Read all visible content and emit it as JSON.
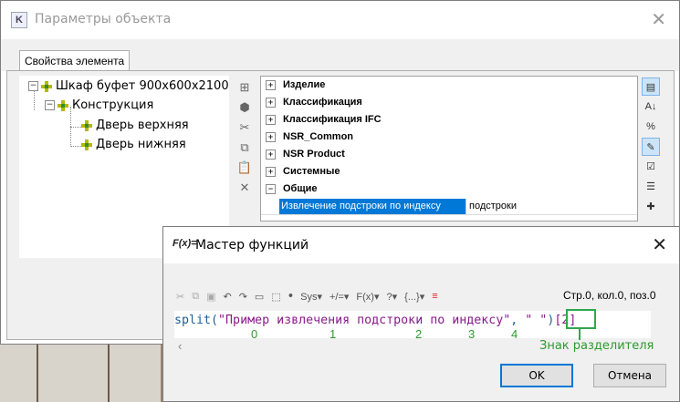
{
  "main_dialog": {
    "title": "Параметры объекта",
    "tab": "Свойства элемента",
    "tree": [
      {
        "label": "Шкаф буфет 900x600x2100",
        "expander": "−"
      },
      {
        "label": "Конструкция",
        "expander": "−"
      },
      {
        "label": "Дверь верхняя"
      },
      {
        "label": "Дверь нижняя"
      }
    ],
    "property_groups": [
      {
        "label": "Изделие",
        "expander": "+"
      },
      {
        "label": "Классификация",
        "expander": "+"
      },
      {
        "label": "Классификация IFC",
        "expander": "+"
      },
      {
        "label": "NSR_Common",
        "expander": "+"
      },
      {
        "label": "NSR Product",
        "expander": "+"
      },
      {
        "label": "Системные",
        "expander": "+"
      },
      {
        "label": "Общие",
        "expander": "−"
      }
    ],
    "selected_property": {
      "name": "Извлечение подстроки по индексу",
      "value": "подстроки"
    }
  },
  "function_wizard": {
    "title": "Мастер функций",
    "icon_text": "F(x)=",
    "toolbar": {
      "sys_label": "Sys",
      "plus_label": "+/=",
      "func_label": "F(x)",
      "help_label": "?",
      "more_label": "{...}"
    },
    "position_info": "Стр.0, кол.0, поз.0",
    "expression": {
      "func": "split(",
      "arg1": "\"Пример извлечения подстроки по индексу\"",
      "sep": ", ",
      "arg2": "\" \"",
      "close": ")",
      "index": "[2]"
    },
    "word_indices": [
      "0",
      "1",
      "2",
      "3",
      "4"
    ],
    "callout": "Знак разделителя",
    "ok_button": "OK",
    "cancel_button": "Отмена"
  },
  "colors": {
    "accent": "#0078d7",
    "annotation_green": "#2fa84f"
  }
}
